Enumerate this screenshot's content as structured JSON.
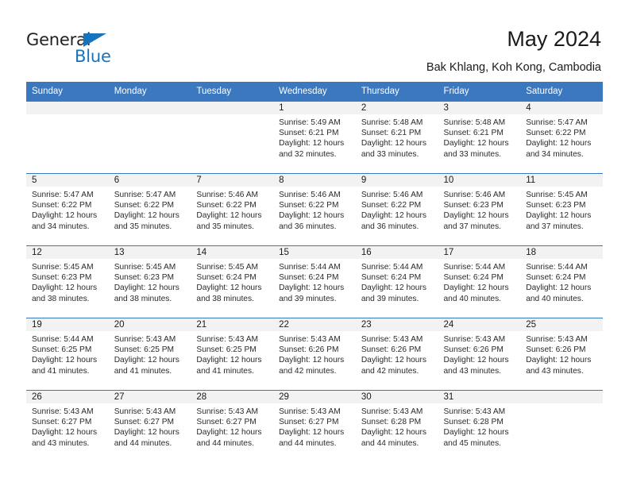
{
  "brand": {
    "name_part1": "General",
    "name_part2": "Blue",
    "accent_color": "#1673be"
  },
  "header": {
    "title": "May 2024",
    "subtitle": "Bak Khlang, Koh Kong, Cambodia"
  },
  "calendar": {
    "header_color": "#3b78bf",
    "daynum_band_color": "#f2f2f2",
    "weekday_headers": [
      "Sunday",
      "Monday",
      "Tuesday",
      "Wednesday",
      "Thursday",
      "Friday",
      "Saturday"
    ],
    "weeks": [
      [
        {
          "day": "",
          "empty": true
        },
        {
          "day": "",
          "empty": true
        },
        {
          "day": "",
          "empty": true
        },
        {
          "day": "1",
          "sunrise": "Sunrise: 5:49 AM",
          "sunset": "Sunset: 6:21 PM",
          "daylight_line1": "Daylight: 12 hours",
          "daylight_line2": "and 32 minutes."
        },
        {
          "day": "2",
          "sunrise": "Sunrise: 5:48 AM",
          "sunset": "Sunset: 6:21 PM",
          "daylight_line1": "Daylight: 12 hours",
          "daylight_line2": "and 33 minutes."
        },
        {
          "day": "3",
          "sunrise": "Sunrise: 5:48 AM",
          "sunset": "Sunset: 6:21 PM",
          "daylight_line1": "Daylight: 12 hours",
          "daylight_line2": "and 33 minutes."
        },
        {
          "day": "4",
          "sunrise": "Sunrise: 5:47 AM",
          "sunset": "Sunset: 6:22 PM",
          "daylight_line1": "Daylight: 12 hours",
          "daylight_line2": "and 34 minutes."
        }
      ],
      [
        {
          "day": "5",
          "sunrise": "Sunrise: 5:47 AM",
          "sunset": "Sunset: 6:22 PM",
          "daylight_line1": "Daylight: 12 hours",
          "daylight_line2": "and 34 minutes."
        },
        {
          "day": "6",
          "sunrise": "Sunrise: 5:47 AM",
          "sunset": "Sunset: 6:22 PM",
          "daylight_line1": "Daylight: 12 hours",
          "daylight_line2": "and 35 minutes."
        },
        {
          "day": "7",
          "sunrise": "Sunrise: 5:46 AM",
          "sunset": "Sunset: 6:22 PM",
          "daylight_line1": "Daylight: 12 hours",
          "daylight_line2": "and 35 minutes."
        },
        {
          "day": "8",
          "sunrise": "Sunrise: 5:46 AM",
          "sunset": "Sunset: 6:22 PM",
          "daylight_line1": "Daylight: 12 hours",
          "daylight_line2": "and 36 minutes."
        },
        {
          "day": "9",
          "sunrise": "Sunrise: 5:46 AM",
          "sunset": "Sunset: 6:22 PM",
          "daylight_line1": "Daylight: 12 hours",
          "daylight_line2": "and 36 minutes."
        },
        {
          "day": "10",
          "sunrise": "Sunrise: 5:46 AM",
          "sunset": "Sunset: 6:23 PM",
          "daylight_line1": "Daylight: 12 hours",
          "daylight_line2": "and 37 minutes."
        },
        {
          "day": "11",
          "sunrise": "Sunrise: 5:45 AM",
          "sunset": "Sunset: 6:23 PM",
          "daylight_line1": "Daylight: 12 hours",
          "daylight_line2": "and 37 minutes."
        }
      ],
      [
        {
          "day": "12",
          "sunrise": "Sunrise: 5:45 AM",
          "sunset": "Sunset: 6:23 PM",
          "daylight_line1": "Daylight: 12 hours",
          "daylight_line2": "and 38 minutes."
        },
        {
          "day": "13",
          "sunrise": "Sunrise: 5:45 AM",
          "sunset": "Sunset: 6:23 PM",
          "daylight_line1": "Daylight: 12 hours",
          "daylight_line2": "and 38 minutes."
        },
        {
          "day": "14",
          "sunrise": "Sunrise: 5:45 AM",
          "sunset": "Sunset: 6:24 PM",
          "daylight_line1": "Daylight: 12 hours",
          "daylight_line2": "and 38 minutes."
        },
        {
          "day": "15",
          "sunrise": "Sunrise: 5:44 AM",
          "sunset": "Sunset: 6:24 PM",
          "daylight_line1": "Daylight: 12 hours",
          "daylight_line2": "and 39 minutes."
        },
        {
          "day": "16",
          "sunrise": "Sunrise: 5:44 AM",
          "sunset": "Sunset: 6:24 PM",
          "daylight_line1": "Daylight: 12 hours",
          "daylight_line2": "and 39 minutes."
        },
        {
          "day": "17",
          "sunrise": "Sunrise: 5:44 AM",
          "sunset": "Sunset: 6:24 PM",
          "daylight_line1": "Daylight: 12 hours",
          "daylight_line2": "and 40 minutes."
        },
        {
          "day": "18",
          "sunrise": "Sunrise: 5:44 AM",
          "sunset": "Sunset: 6:24 PM",
          "daylight_line1": "Daylight: 12 hours",
          "daylight_line2": "and 40 minutes."
        }
      ],
      [
        {
          "day": "19",
          "sunrise": "Sunrise: 5:44 AM",
          "sunset": "Sunset: 6:25 PM",
          "daylight_line1": "Daylight: 12 hours",
          "daylight_line2": "and 41 minutes."
        },
        {
          "day": "20",
          "sunrise": "Sunrise: 5:43 AM",
          "sunset": "Sunset: 6:25 PM",
          "daylight_line1": "Daylight: 12 hours",
          "daylight_line2": "and 41 minutes."
        },
        {
          "day": "21",
          "sunrise": "Sunrise: 5:43 AM",
          "sunset": "Sunset: 6:25 PM",
          "daylight_line1": "Daylight: 12 hours",
          "daylight_line2": "and 41 minutes."
        },
        {
          "day": "22",
          "sunrise": "Sunrise: 5:43 AM",
          "sunset": "Sunset: 6:26 PM",
          "daylight_line1": "Daylight: 12 hours",
          "daylight_line2": "and 42 minutes."
        },
        {
          "day": "23",
          "sunrise": "Sunrise: 5:43 AM",
          "sunset": "Sunset: 6:26 PM",
          "daylight_line1": "Daylight: 12 hours",
          "daylight_line2": "and 42 minutes."
        },
        {
          "day": "24",
          "sunrise": "Sunrise: 5:43 AM",
          "sunset": "Sunset: 6:26 PM",
          "daylight_line1": "Daylight: 12 hours",
          "daylight_line2": "and 43 minutes."
        },
        {
          "day": "25",
          "sunrise": "Sunrise: 5:43 AM",
          "sunset": "Sunset: 6:26 PM",
          "daylight_line1": "Daylight: 12 hours",
          "daylight_line2": "and 43 minutes."
        }
      ],
      [
        {
          "day": "26",
          "sunrise": "Sunrise: 5:43 AM",
          "sunset": "Sunset: 6:27 PM",
          "daylight_line1": "Daylight: 12 hours",
          "daylight_line2": "and 43 minutes."
        },
        {
          "day": "27",
          "sunrise": "Sunrise: 5:43 AM",
          "sunset": "Sunset: 6:27 PM",
          "daylight_line1": "Daylight: 12 hours",
          "daylight_line2": "and 44 minutes."
        },
        {
          "day": "28",
          "sunrise": "Sunrise: 5:43 AM",
          "sunset": "Sunset: 6:27 PM",
          "daylight_line1": "Daylight: 12 hours",
          "daylight_line2": "and 44 minutes."
        },
        {
          "day": "29",
          "sunrise": "Sunrise: 5:43 AM",
          "sunset": "Sunset: 6:27 PM",
          "daylight_line1": "Daylight: 12 hours",
          "daylight_line2": "and 44 minutes."
        },
        {
          "day": "30",
          "sunrise": "Sunrise: 5:43 AM",
          "sunset": "Sunset: 6:28 PM",
          "daylight_line1": "Daylight: 12 hours",
          "daylight_line2": "and 44 minutes."
        },
        {
          "day": "31",
          "sunrise": "Sunrise: 5:43 AM",
          "sunset": "Sunset: 6:28 PM",
          "daylight_line1": "Daylight: 12 hours",
          "daylight_line2": "and 45 minutes."
        },
        {
          "day": "",
          "empty": true
        }
      ]
    ]
  }
}
